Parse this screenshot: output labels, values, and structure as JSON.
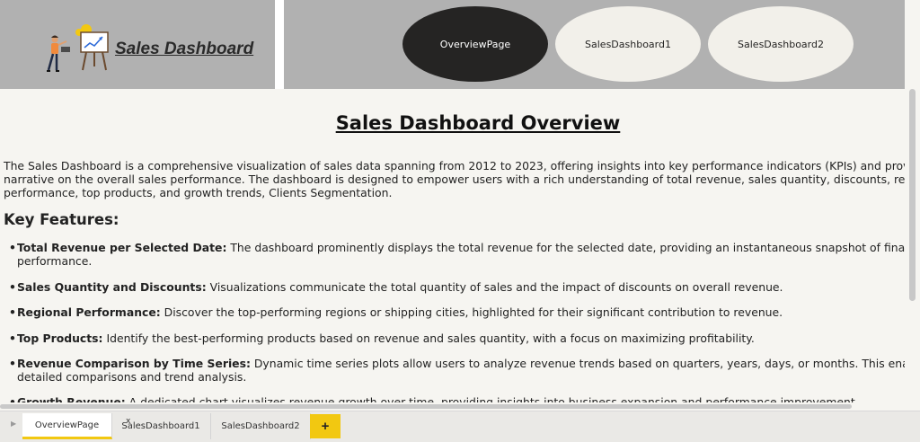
{
  "header": {
    "brand_title": "Sales Dashboard",
    "nav": [
      {
        "label": "OverviewPage",
        "active": true
      },
      {
        "label": "SalesDashboard1",
        "active": false
      },
      {
        "label": "SalesDashboard2",
        "active": false
      }
    ]
  },
  "main": {
    "title": "Sales Dashboard Overview",
    "intro_lines": [
      "The Sales Dashboard is a comprehensive visualization of sales data spanning from 2012 to 2023, offering insights into key performance indicators (KPIs) and provides a",
      "narrative on the overall sales performance. The dashboard is designed to empower users with a rich understanding of total revenue, sales quantity, discounts, regional",
      "performance, top products, and growth trends, Clients Segmentation."
    ],
    "features_heading": "Key Features:",
    "features": [
      {
        "label": "Total Revenue per Selected Date:",
        "text": " The dashboard prominently displays the total revenue for the selected date, providing an instantaneous snapshot of financial",
        "continuation": "performance."
      },
      {
        "label": "Sales Quantity and Discounts:",
        "text": " Visualizations communicate the total quantity of sales and the impact of discounts on overall revenue.",
        "continuation": ""
      },
      {
        "label": "Regional Performance:",
        "text": " Discover the top-performing regions or shipping cities, highlighted for their significant contribution to revenue.",
        "continuation": ""
      },
      {
        "label": "Top Products:",
        "text": " Identify the best-performing products based on revenue and sales quantity, with a focus on maximizing profitability.",
        "continuation": ""
      },
      {
        "label": "Revenue Comparison by Time Series:",
        "text": " Dynamic time series plots allow users to analyze revenue trends based on quarters, years, days, or months. This enables",
        "continuation": "detailed comparisons and trend analysis."
      },
      {
        "label": "Growth Revenue:",
        "text": " A dedicated chart visualizes revenue growth over time, providing insights into business expansion and performance improvement.",
        "continuation": ""
      }
    ]
  },
  "tabs": [
    {
      "label": "OverviewPage",
      "active": true
    },
    {
      "label": "SalesDashboard1",
      "active": false
    },
    {
      "label": "SalesDashboard2",
      "active": false
    }
  ],
  "tab_close_glyph": "x",
  "add_tab_glyph": "+",
  "colors": {
    "accent": "#f2c811",
    "header_bg": "#b1b1b1",
    "active_nav": "#252423",
    "page_bg": "#f6f5f1"
  }
}
